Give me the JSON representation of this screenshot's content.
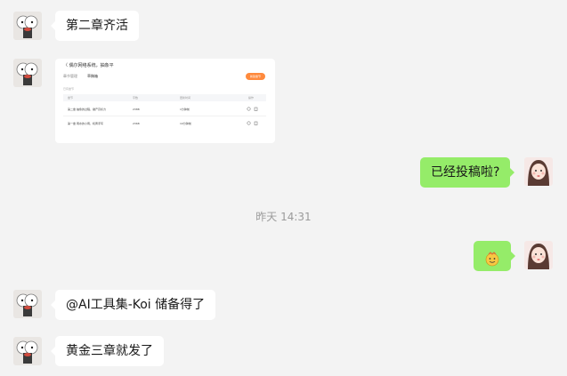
{
  "messages": [
    {
      "side": "in",
      "text": "第二章齐活"
    },
    {
      "side": "in",
      "type": "screenshot"
    },
    {
      "side": "out",
      "text": "已经投稿啦?"
    },
    {
      "side": "out",
      "type": "sticker",
      "sticker": "smiling-emoji-sticker"
    },
    {
      "side": "in",
      "text": "@AI工具集-Koi 储备得了"
    },
    {
      "side": "in",
      "text": "黄金三章就发了"
    }
  ],
  "timestamp": "昨天 14:31",
  "screenshot": {
    "title": "〈 偶尔网络系统，抽象平",
    "tabs": [
      "章节管理",
      "草稿箱"
    ],
    "new_button": "新建章节",
    "section_label": "已有章节",
    "headers": [
      "章节",
      "字数",
      "更新时间",
      "操作"
    ],
    "rows": [
      {
        "chapter": "第二章 抽象的过程，撤产高标力",
        "words": "2388",
        "time": "1分钟前"
      },
      {
        "chapter": "第一章 雨水的小雨，机黄手写",
        "words": "2368",
        "time": "10分钟前"
      }
    ]
  },
  "colors": {
    "out_bubble": "#95ec69",
    "in_bubble": "#ffffff",
    "background": "#f3f3f3",
    "accent_button": "#ff8a3d"
  }
}
